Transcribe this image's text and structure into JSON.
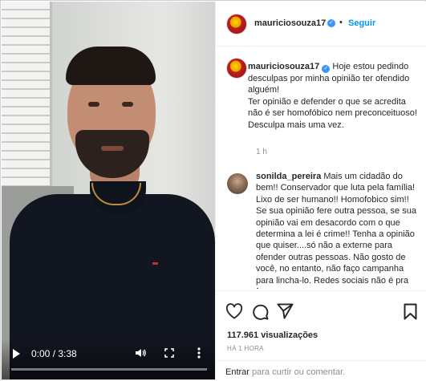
{
  "video": {
    "current_time": "0:00 / 3:38",
    "progress": 0
  },
  "header": {
    "username": "mauriciosouza17",
    "separator": "•",
    "follow_label": "Seguir"
  },
  "caption": {
    "username": "mauriciosouza17",
    "text_line1": "Hoje estou pedindo desculpas por minha opinião ter ofendido alguém!",
    "text_line2": "Ter opinião e defender o que se acredita não é ser homofóbico nem preconceituoso!",
    "text_line3": "Desculpa mais uma vez.",
    "timestamp": "1 h"
  },
  "comment": {
    "username": "sonilda_pereira",
    "text": "Mais um cidadão do bem!! Conservador que luta pela família! Lixo de ser humano!! Homofobico sim!! Se sua opinião fere outra pessoa, se sua opinião vai em desacordo com o que determina a lei é crime!! Tenha a opinião que quiser....só não a externe para ofender outras pessoas. Não gosto de você, no entanto, não faço campanha para lincha-lo. Redes sociais não é pra fazer o que a gente quer..."
  },
  "stats": {
    "views": "117.961 visualizações",
    "time_ago": "HÁ 1 HORA"
  },
  "add_comment": {
    "enter_label": "Entrar",
    "rest": "para curtir ou comentar."
  },
  "colors": {
    "accent": "#0095f6",
    "verified": "#3897f0",
    "text": "#262626",
    "muted": "#8e8e8e"
  },
  "icons": [
    "play-icon",
    "volume-icon",
    "fullscreen-icon",
    "more-options-icon",
    "verified-icon",
    "heart-icon",
    "comment-icon",
    "share-icon",
    "bookmark-icon"
  ]
}
